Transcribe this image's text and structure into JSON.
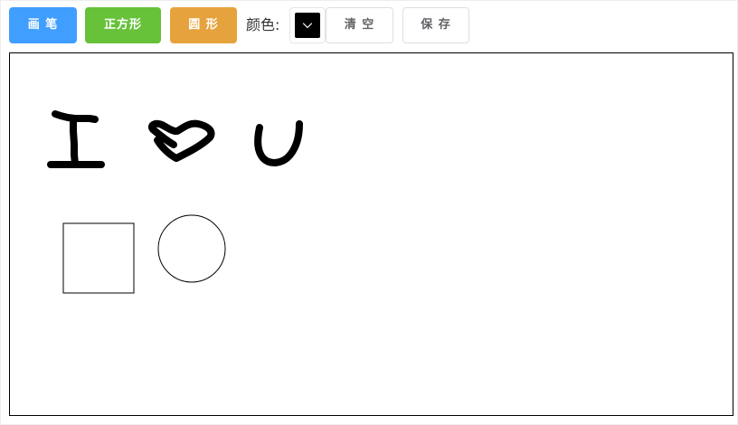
{
  "toolbar": {
    "pen_label": "画 笔",
    "square_label": "正方形",
    "circle_label": "圆 形",
    "color_label": "颜色:",
    "clear_label": "清 空",
    "save_label": "保 存"
  },
  "color_picker": {
    "value": "#000000",
    "icon": "chevron-down-icon"
  },
  "colors": {
    "pen_button": "#409eff",
    "square_button": "#67c23a",
    "circle_button": "#e6a23c",
    "stroke": "#000000"
  }
}
